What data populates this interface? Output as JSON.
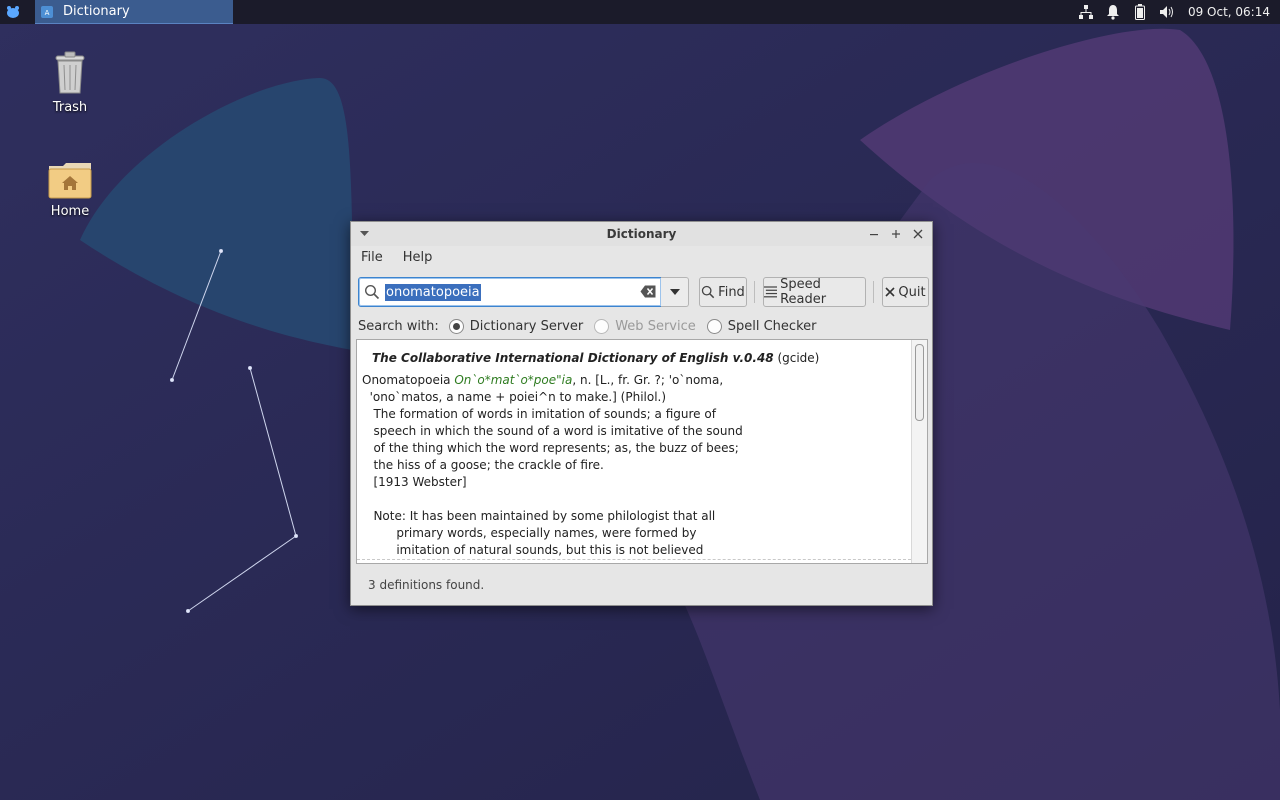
{
  "panel": {
    "task_title": "Dictionary",
    "clock": "09 Oct, 06:14"
  },
  "desktop": {
    "icons": [
      {
        "label": "Trash",
        "icon": "trash-icon"
      },
      {
        "label": "Home",
        "icon": "home-folder-icon"
      }
    ]
  },
  "window": {
    "title": "Dictionary",
    "menu": {
      "file": "File",
      "help": "Help"
    },
    "search": {
      "value": "onomatopoeia"
    },
    "buttons": {
      "find": "Find",
      "speed_reader": "Speed Reader",
      "quit": "Quit"
    },
    "search_with": {
      "label": "Search with:",
      "options": [
        {
          "label": "Dictionary Server",
          "selected": true,
          "enabled": true
        },
        {
          "label": "Web Service",
          "selected": false,
          "enabled": false
        },
        {
          "label": "Spell Checker",
          "selected": false,
          "enabled": true
        }
      ]
    },
    "result": {
      "dict_name": "The Collaborative International Dictionary of English v.0.48",
      "dict_id": " (gcide)",
      "headword": "Onomatopoeia ",
      "pronunciation": "On`o*mat`o*poe\"ia",
      "line1_rest": ", n. [L., fr. Gr. ?; 'o`noma,",
      "lines": [
        "  'ono`matos, a name + poiei^n to make.] (Philol.)",
        "   The formation of words in imitation of sounds; a figure of",
        "   speech in which the sound of a word is imitative of the sound",
        "   of the thing which the word represents; as, the buzz of bees;",
        "   the hiss of a goose; the crackle of fire.",
        "   [1913 Webster]",
        "",
        "   Note: It has been maintained by some philologist that all",
        "         primary words, especially names, were formed by",
        "         imitation of natural sounds, but this is not believed"
      ]
    },
    "status": "3 definitions found."
  }
}
